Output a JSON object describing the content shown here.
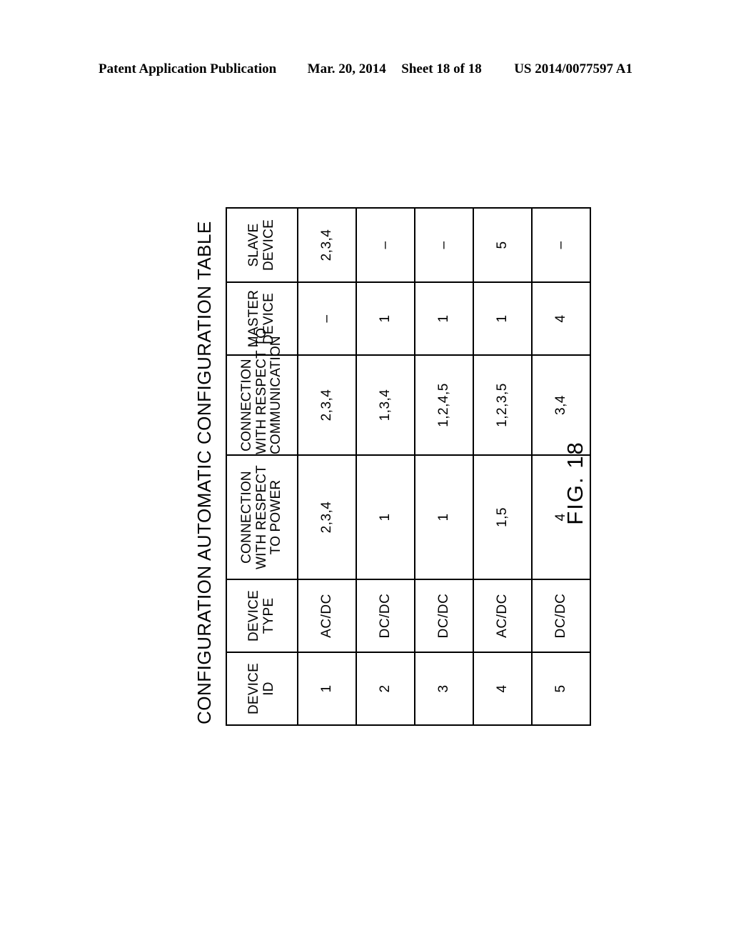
{
  "header": {
    "publication": "Patent Application Publication",
    "date": "Mar. 20, 2014",
    "sheet": "Sheet 18 of 18",
    "patent_number": "US 2014/0077597 A1"
  },
  "figure": {
    "caption": "FIG. 18",
    "table_title": "CONFIGURATION AUTOMATIC CONFIGURATION TABLE"
  },
  "table": {
    "columns": [
      {
        "key": "device_id",
        "lines": [
          "DEVICE",
          "ID"
        ]
      },
      {
        "key": "device_type",
        "lines": [
          "DEVICE",
          "TYPE"
        ]
      },
      {
        "key": "power",
        "lines": [
          "CONNECTION",
          "WITH RESPECT",
          "TO POWER"
        ]
      },
      {
        "key": "comm",
        "lines": [
          "CONNECTION",
          "WITH RESPECT TO",
          "COMMUNICATION"
        ]
      },
      {
        "key": "master",
        "lines": [
          "MASTER",
          "DEVICE"
        ]
      },
      {
        "key": "slave",
        "lines": [
          "SLAVE",
          "DEVICE"
        ]
      }
    ],
    "rows": [
      {
        "device_id": "1",
        "device_type": "AC/DC",
        "power": "2,3,4",
        "comm": "2,3,4",
        "master": "–",
        "slave": "2,3,4"
      },
      {
        "device_id": "2",
        "device_type": "DC/DC",
        "power": "1",
        "comm": "1,3,4",
        "master": "1",
        "slave": "–"
      },
      {
        "device_id": "3",
        "device_type": "DC/DC",
        "power": "1",
        "comm": "1,2,4,5",
        "master": "1",
        "slave": "–"
      },
      {
        "device_id": "4",
        "device_type": "AC/DC",
        "power": "1,5",
        "comm": "1,2,3,5",
        "master": "1",
        "slave": "5"
      },
      {
        "device_id": "5",
        "device_type": "DC/DC",
        "power": "4",
        "comm": "3,4",
        "master": "4",
        "slave": "–"
      }
    ]
  }
}
